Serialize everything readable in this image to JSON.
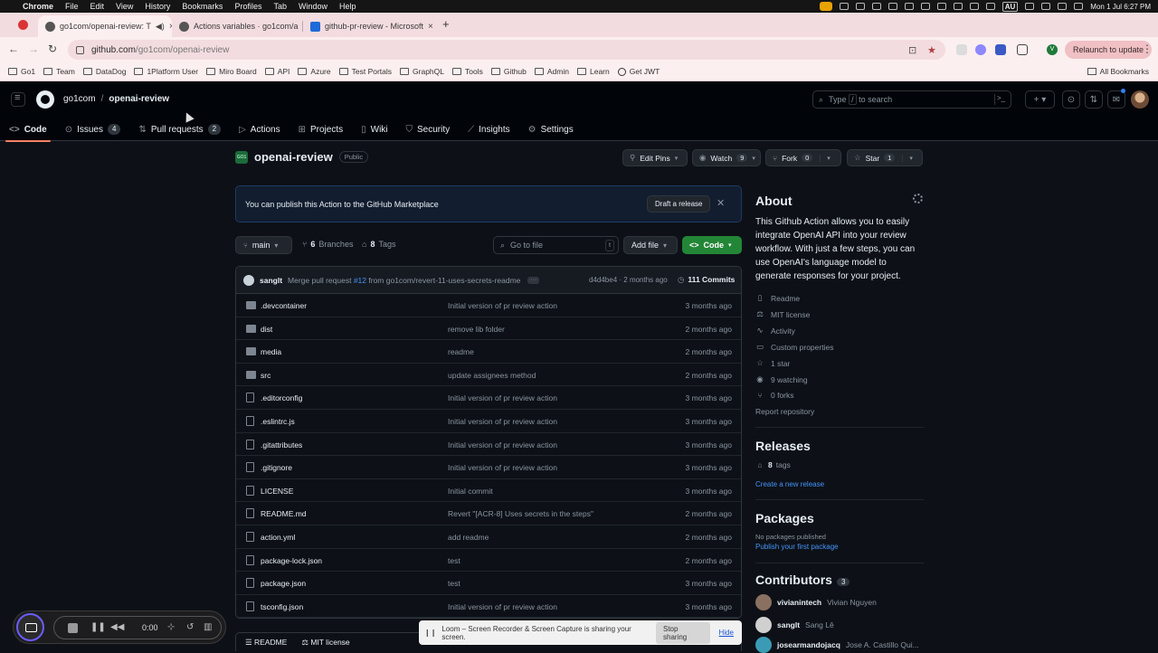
{
  "macbar": {
    "app": "Chrome",
    "menus": [
      "File",
      "Edit",
      "View",
      "History",
      "Bookmarks",
      "Profiles",
      "Tab",
      "Window",
      "Help"
    ],
    "datetime": "Mon 1 Jul  6:27 PM",
    "input_source": "AU"
  },
  "browser": {
    "tabs": [
      {
        "title": "go1com/openai-review: T",
        "active": true
      },
      {
        "title": "Actions variables · go1com/a",
        "active": false
      },
      {
        "title": "github-pr-review - Microsoft",
        "active": false
      }
    ],
    "url_host": "github.com",
    "url_path": "/go1com/openai-review",
    "profile_initial": "V",
    "relaunch_label": "Relaunch to update",
    "bookmarks": [
      "Go1",
      "Team",
      "DataDog",
      "1Platform User",
      "Miro Board",
      "API",
      "Azure",
      "Test Portals",
      "GraphQL",
      "Tools",
      "Github",
      "Admin",
      "Learn",
      "Get JWT"
    ],
    "all_bookmarks": "All Bookmarks"
  },
  "github": {
    "owner": "go1com",
    "repo": "openai-review",
    "search_prefix": "Type",
    "search_key": "/",
    "search_suffix": "to search",
    "nav": [
      {
        "label": "Code",
        "icon": "code-icon",
        "selected": true
      },
      {
        "label": "Issues",
        "icon": "issue-icon",
        "count": "4"
      },
      {
        "label": "Pull requests",
        "icon": "pull-request-icon",
        "count": "2"
      },
      {
        "label": "Actions",
        "icon": "play-icon"
      },
      {
        "label": "Projects",
        "icon": "table-icon"
      },
      {
        "label": "Wiki",
        "icon": "book-icon"
      },
      {
        "label": "Security",
        "icon": "shield-icon"
      },
      {
        "label": "Insights",
        "icon": "graph-icon"
      },
      {
        "label": "Settings",
        "icon": "gear-icon"
      }
    ],
    "org_avatar_text": "GO1",
    "visibility": "Public",
    "actions": {
      "edit_pins": "Edit Pins",
      "watch": "Watch",
      "watch_count": "9",
      "fork": "Fork",
      "fork_count": "0",
      "star": "Star",
      "star_count": "1"
    },
    "banner": {
      "message": "You can publish this Action to the GitHub Marketplace",
      "button": "Draft a release"
    },
    "branch": "main",
    "branches_count": "6",
    "branches_label": "Branches",
    "tags_count": "8",
    "tags_label": "Tags",
    "goto_file": "Go to file",
    "goto_key": "t",
    "add_file": "Add file",
    "code_button": "Code",
    "latest_commit": {
      "author": "sanglt",
      "message_prefix": "Merge pull request",
      "pr": "#12",
      "message_suffix": "from go1com/revert-11-uses-secrets-readme",
      "sha": "d4d4be4",
      "age": "2 months ago",
      "commits": "111 Commits"
    },
    "files": [
      {
        "name": ".devcontainer",
        "type": "dir",
        "message": "Initial version of pr review action",
        "age": "3 months ago"
      },
      {
        "name": "dist",
        "type": "dir",
        "message": "remove lib folder",
        "age": "2 months ago"
      },
      {
        "name": "media",
        "type": "dir",
        "message": "readme",
        "age": "2 months ago"
      },
      {
        "name": "src",
        "type": "dir",
        "message": "update assignees method",
        "age": "2 months ago"
      },
      {
        "name": ".editorconfig",
        "type": "file",
        "message": "Initial version of pr review action",
        "age": "3 months ago"
      },
      {
        "name": ".eslintrc.js",
        "type": "file",
        "message": "Initial version of pr review action",
        "age": "3 months ago"
      },
      {
        "name": ".gitattributes",
        "type": "file",
        "message": "Initial version of pr review action",
        "age": "3 months ago"
      },
      {
        "name": ".gitignore",
        "type": "file",
        "message": "Initial version of pr review action",
        "age": "3 months ago"
      },
      {
        "name": "LICENSE",
        "type": "file",
        "message": "Initial commit",
        "age": "3 months ago"
      },
      {
        "name": "README.md",
        "type": "file",
        "message": "Revert \"[ACR-8] Uses secrets in the steps\"",
        "age": "2 months ago"
      },
      {
        "name": "action.yml",
        "type": "file",
        "message": "add readme",
        "age": "2 months ago"
      },
      {
        "name": "package-lock.json",
        "type": "file",
        "message": "test",
        "age": "2 months ago"
      },
      {
        "name": "package.json",
        "type": "file",
        "message": "test",
        "age": "3 months ago"
      },
      {
        "name": "tsconfig.json",
        "type": "file",
        "message": "Initial version of pr review action",
        "age": "3 months ago"
      }
    ],
    "readme_tabs": [
      "README",
      "MIT license"
    ],
    "about": {
      "title": "About",
      "description": "This Github Action allows you to easily integrate OpenAI API into your review workflow. With just a few steps, you can use OpenAI's language model to generate responses for your project.",
      "links": [
        {
          "label": "Readme",
          "icon": "book-icon"
        },
        {
          "label": "MIT license",
          "icon": "law-icon"
        },
        {
          "label": "Activity",
          "icon": "pulse-icon"
        },
        {
          "label": "Custom properties",
          "icon": "note-icon"
        },
        {
          "label": "1 star",
          "icon": "star-icon"
        },
        {
          "label": "9 watching",
          "icon": "eye-icon"
        },
        {
          "label": "0 forks",
          "icon": "fork-icon"
        }
      ],
      "report": "Report repository"
    },
    "releases": {
      "title": "Releases",
      "tags_count": "8",
      "tags_label": "tags",
      "create": "Create a new release"
    },
    "packages": {
      "title": "Packages",
      "none": "No packages published",
      "publish": "Publish your first package"
    },
    "contributors": {
      "title": "Contributors",
      "count": "3",
      "list": [
        {
          "login": "vivianintech",
          "name": "Vivian Nguyen"
        },
        {
          "login": "sanglt",
          "name": "Sang Lê"
        },
        {
          "login": "josearmandojacq",
          "name": "Jose A. Castillo Qui..."
        }
      ]
    }
  },
  "loom": {
    "timer": "0:00",
    "notice": "Loom – Screen Recorder & Screen Capture is sharing your screen.",
    "stop": "Stop sharing",
    "hide": "Hide"
  }
}
